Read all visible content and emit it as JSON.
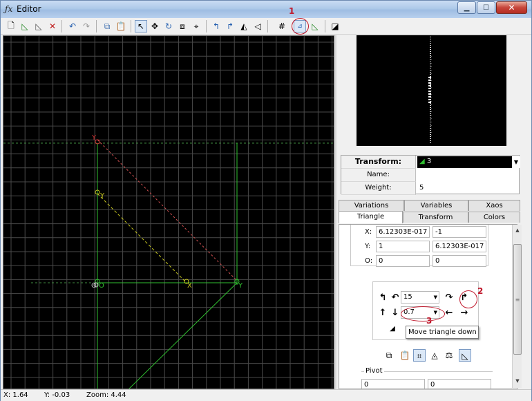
{
  "window": {
    "title": "Editor",
    "icon": "fx-icon",
    "buttons": [
      "minimize",
      "maximize",
      "close"
    ]
  },
  "toolbar": {
    "icons": [
      "new-icon",
      "add-icon",
      "duplicate-icon",
      "delete-icon",
      "undo-icon",
      "redo-icon",
      "copy-icon",
      "paste-icon",
      "select-icon",
      "move-icon",
      "rotate-icon",
      "scale-icon",
      "pan-icon",
      "rotate-ccw-icon",
      "rotate-cw-icon",
      "flip-h-icon",
      "flip-v-icon",
      "grid-icon",
      "post-transform-icon",
      "final-transform-icon",
      "reset-icon"
    ]
  },
  "canvas": {
    "points": {
      "x_label": "X",
      "y_label": "Y",
      "o_label": "O",
      "o2_label": "O"
    }
  },
  "transform_panel": {
    "transform_label": "Transform:",
    "transform_value": "3",
    "name_label": "Name:",
    "name_value": "",
    "weight_label": "Weight:",
    "weight_value": "5"
  },
  "tabs": {
    "row1": [
      "Variations",
      "Variables",
      "Xaos"
    ],
    "row2": [
      "Triangle",
      "Transform",
      "Colors"
    ],
    "active": "Triangle"
  },
  "triangle": {
    "x_label": "X:",
    "x_a": "6.12303E-017",
    "x_b": "-1",
    "y_label": "Y:",
    "y_a": "1",
    "y_b": "6.12303E-017",
    "o_label": "O:",
    "o_a": "0",
    "o_b": "0",
    "rotate_value": "15",
    "move_value": "0.7",
    "tooltip": "Move triangle down",
    "pivot_label": "Pivot",
    "pivot_a": "0",
    "pivot_b": "0"
  },
  "status": {
    "x": "X: 1.64",
    "y": "Y: -0.03",
    "zoom": "Zoom: 4.44"
  },
  "annotations": {
    "n1": "1",
    "n2": "2",
    "n3": "3"
  },
  "colors": {
    "annotation": "#c0182c",
    "grid": "#4a4a4a",
    "triangle_green": "#2fbf2f",
    "triangle_yellow": "#c8c820",
    "reference_red": "#d03030"
  }
}
